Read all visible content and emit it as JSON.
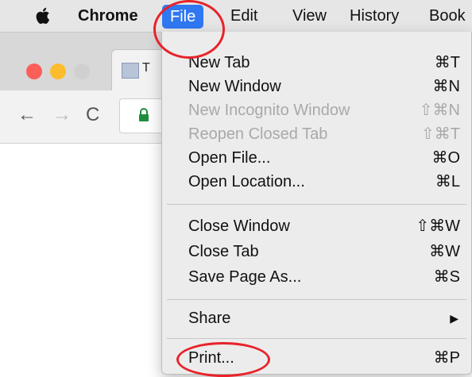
{
  "menubar": {
    "app_name": "Chrome",
    "items": [
      "File",
      "Edit",
      "View",
      "History",
      "Book"
    ]
  },
  "browser": {
    "tab_title": "T"
  },
  "file_menu": {
    "items": [
      {
        "label": "New Tab",
        "shortcut": "⌘T",
        "enabled": true
      },
      {
        "label": "New Window",
        "shortcut": "⌘N",
        "enabled": true
      },
      {
        "label": "New Incognito Window",
        "shortcut": "⇧⌘N",
        "enabled": false
      },
      {
        "label": "Reopen Closed Tab",
        "shortcut": "⇧⌘T",
        "enabled": false
      },
      {
        "label": "Open File...",
        "shortcut": "⌘O",
        "enabled": true
      },
      {
        "label": "Open Location...",
        "shortcut": "⌘L",
        "enabled": true
      },
      {
        "label": "Close Window",
        "shortcut": "⇧⌘W",
        "enabled": true
      },
      {
        "label": "Close Tab",
        "shortcut": "⌘W",
        "enabled": true
      },
      {
        "label": "Save Page As...",
        "shortcut": "⌘S",
        "enabled": true
      },
      {
        "label": "Share",
        "shortcut": "▶",
        "enabled": true
      },
      {
        "label": "Print...",
        "shortcut": "⌘P",
        "enabled": true
      }
    ]
  },
  "colors": {
    "menu_highlight": "#2f78f2",
    "annotation_red": "#e8232a"
  }
}
